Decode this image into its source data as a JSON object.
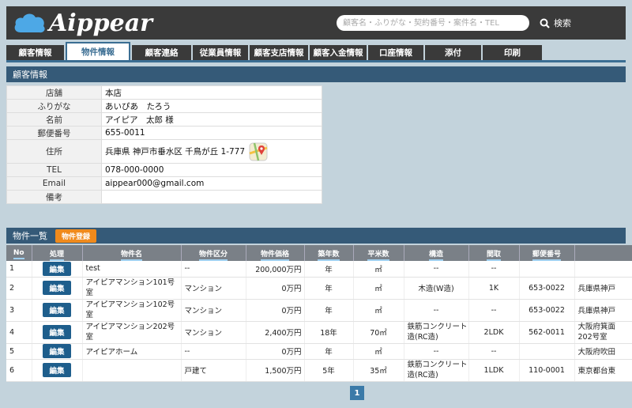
{
  "app": {
    "logo_text": "Aippear",
    "search_placeholder": "顧客名・ふりがな・契約番号・案件名・TEL",
    "search_label": "検索"
  },
  "tabs": [
    {
      "label": "顧客情報"
    },
    {
      "label": "物件情報"
    },
    {
      "label": "顧客連絡"
    },
    {
      "label": "従業員情報"
    },
    {
      "label": "顧客支店情報"
    },
    {
      "label": "顧客入金情報"
    },
    {
      "label": "口座情報"
    },
    {
      "label": "添付"
    },
    {
      "label": "印刷"
    }
  ],
  "customer": {
    "section_title": "顧客情報",
    "rows": [
      {
        "label": "店舗",
        "value": "本店"
      },
      {
        "label": "ふりがな",
        "value": "あいぴあ　たろう"
      },
      {
        "label": "名前",
        "value": "アイピア　太郎 様"
      },
      {
        "label": "郵便番号",
        "value": "655-0011"
      },
      {
        "label": "住所",
        "value": "兵庫県 神戸市垂水区 千鳥が丘 1-777"
      },
      {
        "label": "TEL",
        "value": "078-000-0000"
      },
      {
        "label": "Email",
        "value": "aippear000@gmail.com"
      },
      {
        "label": "備考",
        "value": ""
      }
    ]
  },
  "properties": {
    "section_title": "物件一覧",
    "register_label": "物件登録",
    "edit_label": "編集",
    "columns": [
      "No",
      "処理",
      "物件名",
      "物件区分",
      "物件価格",
      "築年数",
      "平米数",
      "構造",
      "間取",
      "郵便番号",
      ""
    ],
    "rows": [
      {
        "no": "1",
        "name": "test",
        "category": "--",
        "price": "200,000万円",
        "age": "年",
        "area": "㎡",
        "structure": "--",
        "layout": "--",
        "postal": "",
        "address": ""
      },
      {
        "no": "2",
        "name": "アイピアマンション101号室",
        "category": "マンション",
        "price": "0万円",
        "age": "年",
        "area": "㎡",
        "structure": "木造(W造)",
        "layout": "1K",
        "postal": "653-0022",
        "address": "兵庫県神戸"
      },
      {
        "no": "3",
        "name": "アイピアマンション102号室",
        "category": "マンション",
        "price": "0万円",
        "age": "年",
        "area": "㎡",
        "structure": "--",
        "layout": "--",
        "postal": "653-0022",
        "address": "兵庫県神戸"
      },
      {
        "no": "4",
        "name": "アイピアマンション202号室",
        "category": "マンション",
        "price": "2,400万円",
        "age": "18年",
        "area": "70㎡",
        "structure": "鉄筋コンクリート造(RC造)",
        "layout": "2LDK",
        "postal": "562-0011",
        "address": "大阪府箕面 202号室"
      },
      {
        "no": "5",
        "name": "アイピアホーム",
        "category": "--",
        "price": "0万円",
        "age": "年",
        "area": "㎡",
        "structure": "--",
        "layout": "--",
        "postal": "",
        "address": "大阪府吹田"
      },
      {
        "no": "6",
        "name": "",
        "category": "戸建て",
        "price": "1,500万円",
        "age": "5年",
        "area": "35㎡",
        "structure": "鉄筋コンクリート造(RC造)",
        "layout": "1LDK",
        "postal": "110-0001",
        "address": "東京都台東"
      }
    ]
  },
  "pagination": {
    "current": "1"
  },
  "colors": {
    "header_bar": "#3a3a3a",
    "section_blue": "#355a78",
    "accent_orange": "#f08a1c",
    "edit_blue": "#1e5e8c",
    "background": "#c3d3dc"
  }
}
